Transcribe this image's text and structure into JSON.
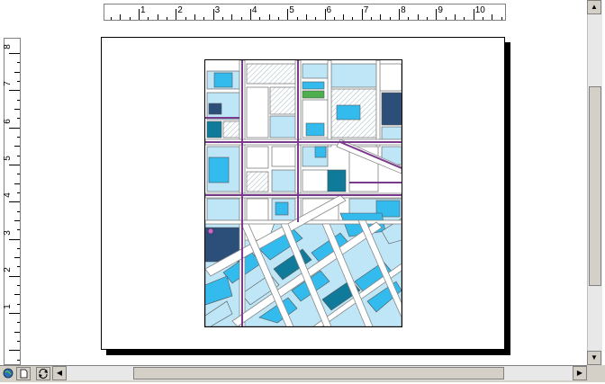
{
  "ruler_top": {
    "labels": [
      "1",
      "2",
      "3",
      "4",
      "5",
      "6",
      "7",
      "8",
      "9",
      "10"
    ]
  },
  "ruler_left": {
    "labels": [
      "8",
      "7",
      "6",
      "5",
      "4",
      "3",
      "2",
      "1"
    ]
  },
  "colors": {
    "parcel_light": "#bfe6f7",
    "parcel_mid": "#33bbee",
    "parcel_dark": "#107a9a",
    "parcel_navy": "#2b4f78",
    "road_fill": "#ffffff",
    "road_edge": "#888888",
    "major_road": "#7a3b8c",
    "park": "#4cae4c"
  },
  "icons": {
    "globe": "globe-icon",
    "page": "page-icon",
    "refresh": "refresh-icon",
    "scroll_left": "arrow-left-icon",
    "scroll_right": "arrow-right-icon",
    "scroll_up": "arrow-up-icon",
    "scroll_down": "arrow-down-icon"
  }
}
